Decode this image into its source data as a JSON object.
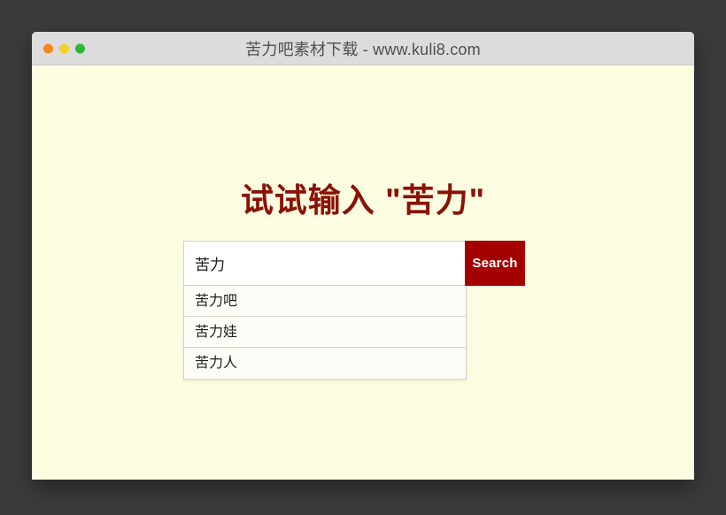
{
  "window": {
    "title": "苦力吧素材下载 - www.kuli8.com",
    "traffic_lights": [
      {
        "name": "close",
        "color": "#f4871f"
      },
      {
        "name": "minimize",
        "color": "#f0d12b"
      },
      {
        "name": "maximize",
        "color": "#2cb836"
      }
    ]
  },
  "page": {
    "background_color": "#fdfde1",
    "headline": "试试输入 \"苦力\"",
    "headline_color": "#8a1205"
  },
  "search": {
    "value": "苦力",
    "placeholder": "",
    "button_label": "Search",
    "button_color": "#a40000",
    "suggestions": [
      {
        "label": "苦力吧"
      },
      {
        "label": "苦力娃"
      },
      {
        "label": "苦力人"
      }
    ]
  }
}
